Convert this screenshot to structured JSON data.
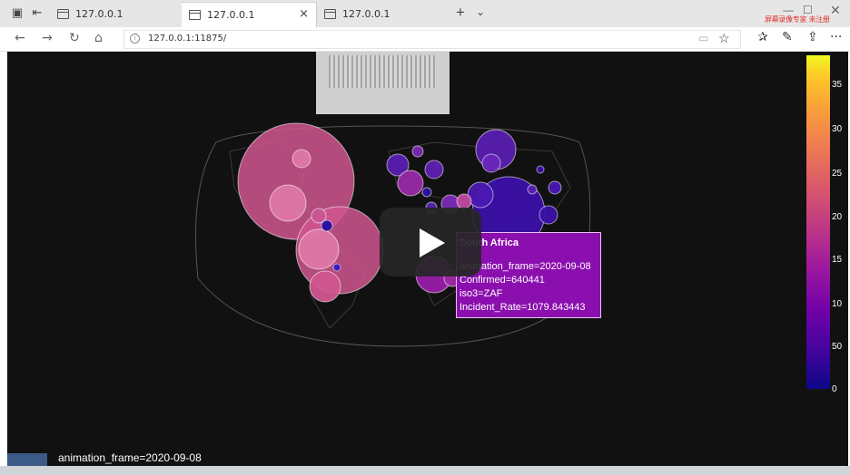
{
  "browser": {
    "tabs": [
      {
        "title": "127.0.0.1"
      },
      {
        "title": "127.0.0.1",
        "close": "×"
      },
      {
        "title": "127.0.0.1"
      }
    ],
    "new_tab": "+",
    "tab_list": "⌄",
    "overlay_text": "屏幕录像专家 未注册",
    "url": "127.0.0.1:11875/",
    "nav": {
      "back": "←",
      "forward": "→",
      "refresh": "↻",
      "home": "⌂"
    },
    "tools": {
      "favorites": "✰",
      "notes": "✎",
      "share": "⇪",
      "more": "···"
    }
  },
  "chart": {
    "tooltip": {
      "title": "South Africa",
      "animation_frame_line": "animation_frame=2020-09-08",
      "confirmed_line": "Confirmed=640441",
      "iso3_line": "iso3=ZAF",
      "incident_rate_line": "Incident_Rate=1079.843443"
    },
    "colorbar_ticks": [
      "35",
      "30",
      "25",
      "20",
      "15",
      "10",
      "50",
      "0"
    ],
    "animation_frame_label": "animation_frame=2020-09-08"
  },
  "chart_data": {
    "type": "scatter",
    "title": "",
    "color_scale": "plasma",
    "colorbar_ticks": [
      "35",
      "30",
      "25",
      "20",
      "15",
      "10",
      "50",
      "0"
    ],
    "animation_frame": "2020-09-08",
    "highlighted_point": {
      "name": "South Africa",
      "Confirmed": 640441,
      "iso3": "ZAF",
      "Incident_Rate": 1079.843443
    }
  },
  "colors": {
    "page_bg": "#111111",
    "tooltip_bg": "#8b0fae",
    "bubble_pink": "#d0568f",
    "bubble_purple": "#5a1fb0",
    "bubble_dark_blue": "#3b10a8"
  }
}
